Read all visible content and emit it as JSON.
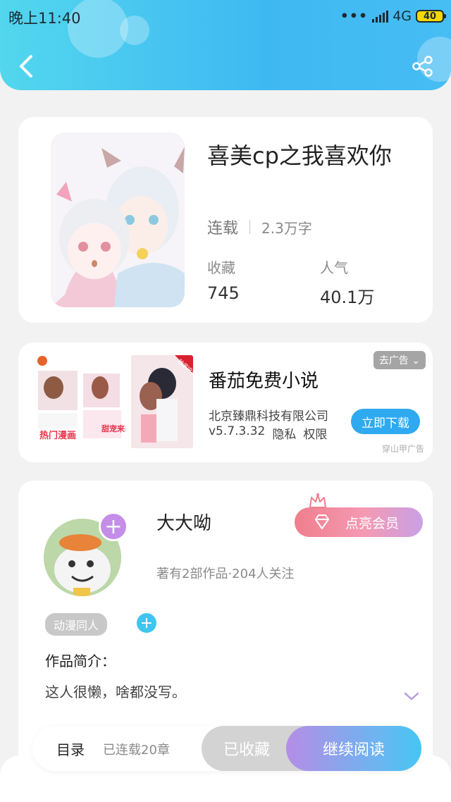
{
  "status_bar": {
    "time": "晚上11:40",
    "network": "4G",
    "battery": "40"
  },
  "header": {
    "back_icon": "chevron-left-icon",
    "share_icon": "share-icon",
    "accent_colors": [
      "#52d7ee",
      "#3fb8f2"
    ]
  },
  "book": {
    "title": "喜美cp之我喜欢你",
    "status": "连载",
    "word_count": "2.3万字",
    "favorites_label": "收藏",
    "favorites_value": "745",
    "popularity_label": "人气",
    "popularity_value": "40.1万"
  },
  "ad": {
    "remove_label": "去广告",
    "title": "番茄免费小说",
    "company": "北京臻鼎科技有限公司",
    "version": "v5.7.3.32",
    "privacy": "隐私",
    "permissions": "权限",
    "download_label": "立即下载",
    "source": "穿山甲广告",
    "thumb1_caption": "热门漫画",
    "thumb2_caption": "甜宠来袭",
    "thumb3_badge": "独家IP漫画"
  },
  "author": {
    "name": "大大呦",
    "meta": "著有2部作品·204人关注",
    "vip_label": "点亮会员",
    "tag": "动漫同人",
    "intro_label": "作品简介：",
    "intro_text": "这人很懒，啥都没写。"
  },
  "bottom": {
    "toc_label": "目录",
    "chapter_count": "已连载20章",
    "collected_label": "已收藏",
    "continue_label": "继续阅读"
  }
}
